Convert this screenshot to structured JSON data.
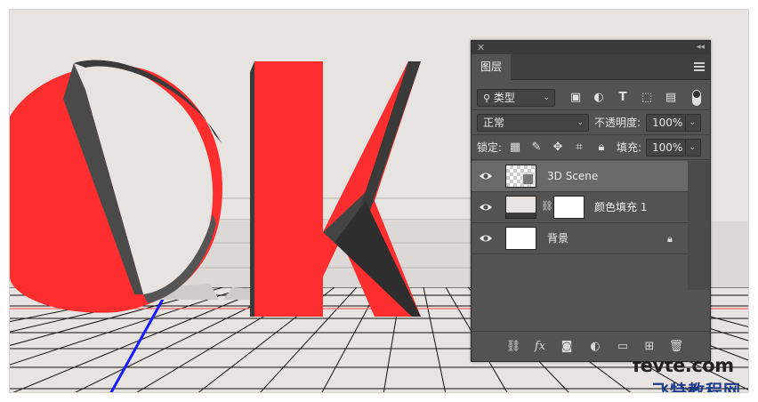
{
  "panel": {
    "title": "图层",
    "filter_kind": "类型",
    "blend_mode": "正常",
    "opacity_label": "不透明度:",
    "opacity_value": "100%",
    "lock_label": "锁定:",
    "fill_label": "填充:",
    "fill_value": "100%"
  },
  "layers": [
    {
      "name": "3D Scene",
      "selected": true,
      "visible": true
    },
    {
      "name": "颜色填充 1",
      "selected": false,
      "visible": true
    },
    {
      "name": "背景",
      "selected": false,
      "visible": true,
      "locked": true
    }
  ],
  "bottom_toolbar": {
    "icons": [
      "link-layers-icon",
      "fx-icon",
      "add-mask-icon",
      "adjustment-layer-icon",
      "new-group-icon",
      "new-layer-icon",
      "delete-layer-icon"
    ],
    "fx_label": "fx"
  },
  "scene": {
    "letters": "OK",
    "letter_color": "#ff2e2e",
    "floor_color": "#000000",
    "background": "#e7e3e0"
  },
  "watermark": {
    "line1_a": "fe",
    "line1_b": "v",
    "line1_c": "te.com",
    "line2": "飞特教程网"
  }
}
